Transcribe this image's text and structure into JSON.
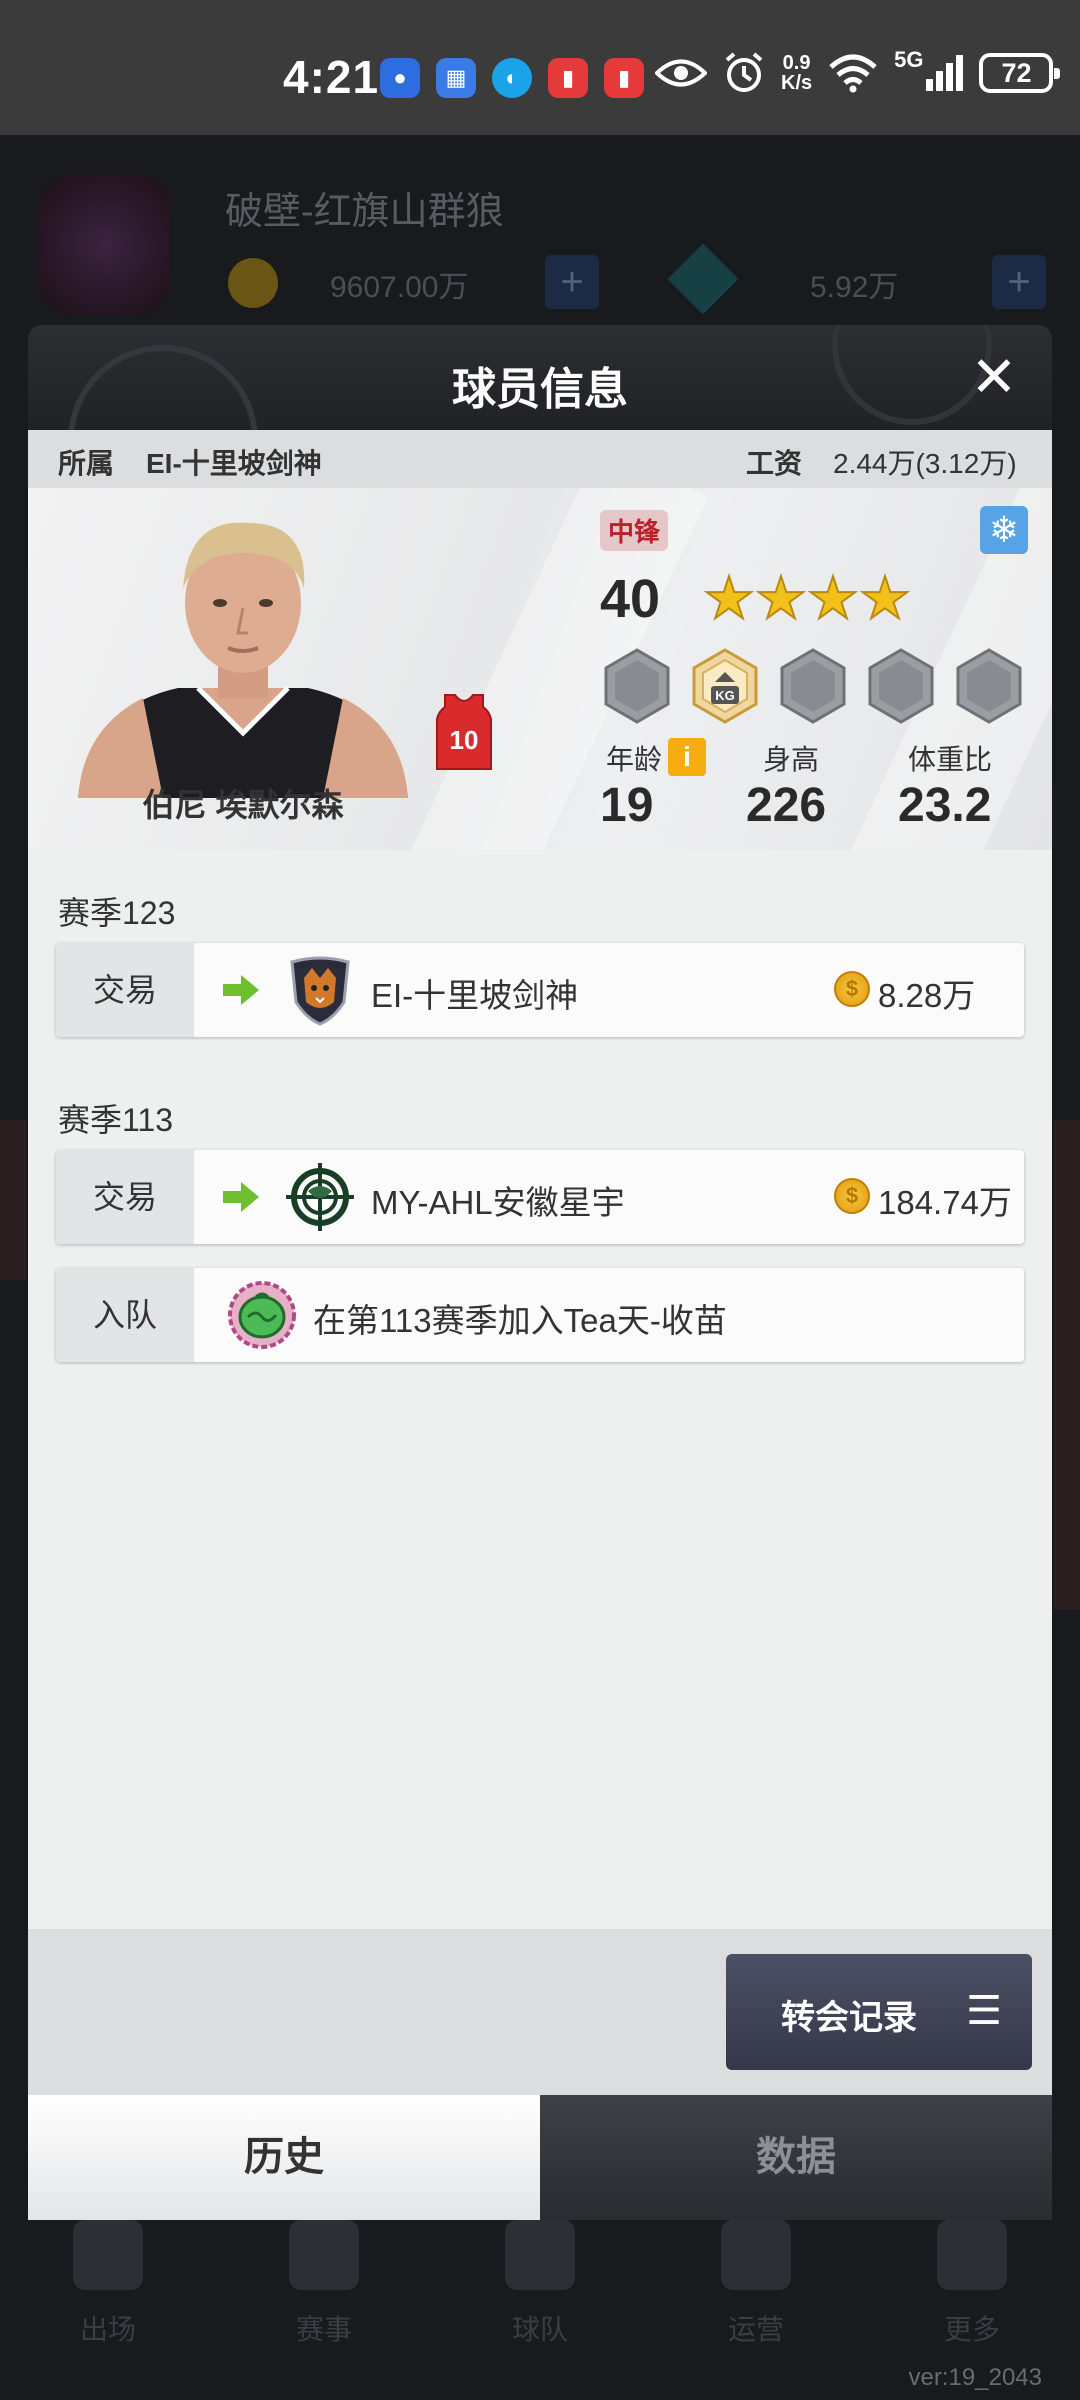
{
  "status_bar": {
    "time": "4:21",
    "net_speed_value": "0.9",
    "net_speed_unit": "K/s",
    "network": "5G",
    "battery": "72"
  },
  "background_app": {
    "team_name": "破壁-红旗山群狼",
    "money": "9607.00万",
    "gems": "5.92万",
    "nav": [
      "出场",
      "赛事",
      "球队",
      "运营",
      "更多"
    ],
    "version": "ver:19_2043"
  },
  "dialog": {
    "title": "球员信息",
    "team_label": "所属",
    "team_value": "EI-十里坡剑神",
    "salary_label": "工资",
    "salary_value": "2.44万(3.12万)",
    "player": {
      "name": "伯尼 埃默尔森",
      "jersey_number": "10",
      "position": "中锋",
      "rating": "40",
      "stars": 4,
      "badge_label": "KG",
      "age_label": "年龄",
      "age": "19",
      "height_label": "身高",
      "height": "226",
      "weight_ratio_label": "体重比",
      "weight_ratio": "23.2"
    },
    "history": [
      {
        "season": "赛季123",
        "records": [
          {
            "type": "交易",
            "team": "EI-十里坡剑神",
            "fee": "8.28万"
          }
        ]
      },
      {
        "season": "赛季113",
        "records": [
          {
            "type": "交易",
            "team": "MY-AHL安徽星宇",
            "fee": "184.74万"
          },
          {
            "type": "入队",
            "team": "在第113赛季加入Tea天-收苗",
            "fee": ""
          }
        ]
      }
    ],
    "transfer_button": "转会记录",
    "tabs": {
      "history": "历史",
      "data": "数据"
    }
  }
}
